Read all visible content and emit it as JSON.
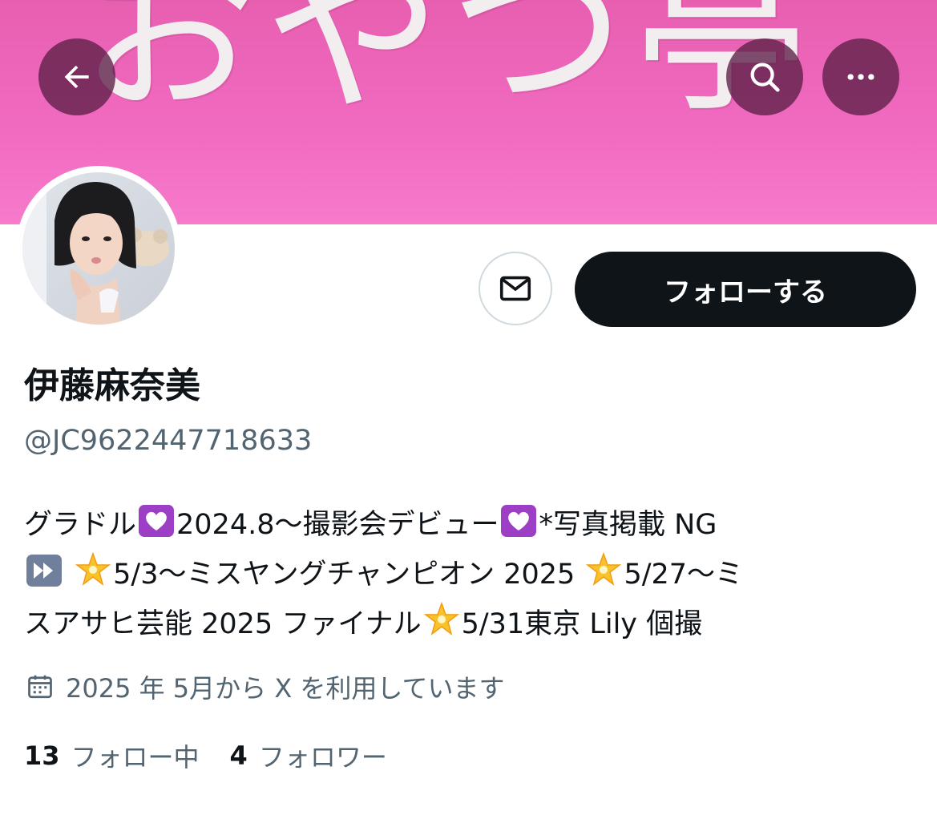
{
  "banner": {
    "text": "おやつ亭",
    "color": "#f06ac0"
  },
  "header": {
    "back_icon": "back-arrow-icon",
    "search_icon": "search-icon",
    "more_icon": "more-icon"
  },
  "profile": {
    "display_name": "伊藤麻奈美",
    "handle": "@JC9622447718633",
    "follow_label": "フォローする",
    "message_icon": "envelope-icon"
  },
  "bio": {
    "line1": [
      "グラドル",
      "2024.8～撮影会デビュー",
      "*写真掲載 NG"
    ],
    "line2": [
      "5/3～ミスヤングチャンピオン 2025 ",
      "5/27～ミ"
    ],
    "line3": [
      "スアサヒ芸能 2025 ファイナル",
      "5/31東京 Lily 個撮"
    ],
    "emoji": [
      "heart-emoji",
      "fast-forward-emoji",
      "glowing-star-emoji"
    ]
  },
  "joined": {
    "text": "2025 年 5月から X を利用しています",
    "icon": "calendar-icon"
  },
  "stats": {
    "following_count": "13",
    "following_label": "フォロー中",
    "followers_count": "4",
    "followers_label": "フォロワー"
  },
  "colors": {
    "primary_text": "#0f1419",
    "secondary_text": "#536471",
    "follow_button_bg": "#0f1419",
    "border": "#cfd9de"
  }
}
